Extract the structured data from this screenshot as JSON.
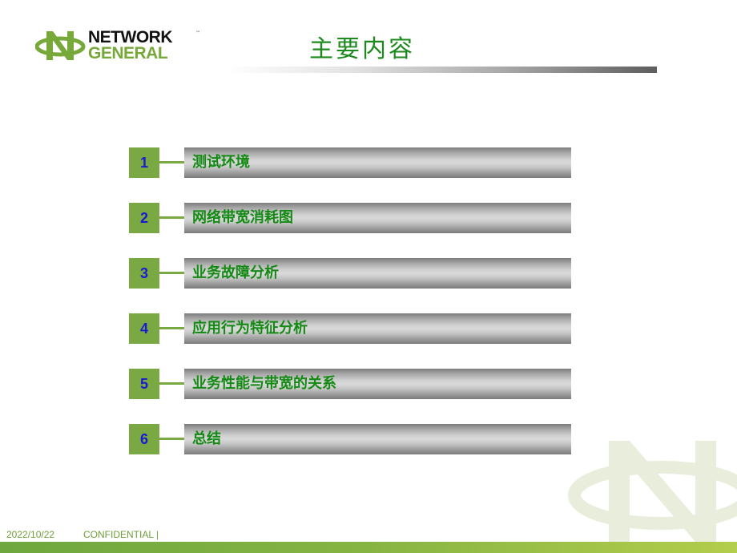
{
  "logo": {
    "line1": "NETWORK",
    "line2": "GENERAL",
    "trademark": "™",
    "icon": "network-general-n-orbit-icon"
  },
  "title": "主要内容",
  "menu": {
    "items": [
      {
        "number": "1",
        "label": "测试环境"
      },
      {
        "number": "2",
        "label": "网络带宽消耗图"
      },
      {
        "number": "3",
        "label": "业务故障分析"
      },
      {
        "number": "4",
        "label": "应用行为特征分析"
      },
      {
        "number": "5",
        "label": "业务性能与带宽的关系"
      },
      {
        "number": "6",
        "label": "总结"
      }
    ]
  },
  "footer": {
    "date": "2022/10/22",
    "confidential": "CONFIDENTIAL  |"
  },
  "colors": {
    "brand_green": "#7aa843",
    "title_green": "#1d8a1d",
    "number_blue": "#1a1ad0",
    "label_green": "#138a13"
  }
}
